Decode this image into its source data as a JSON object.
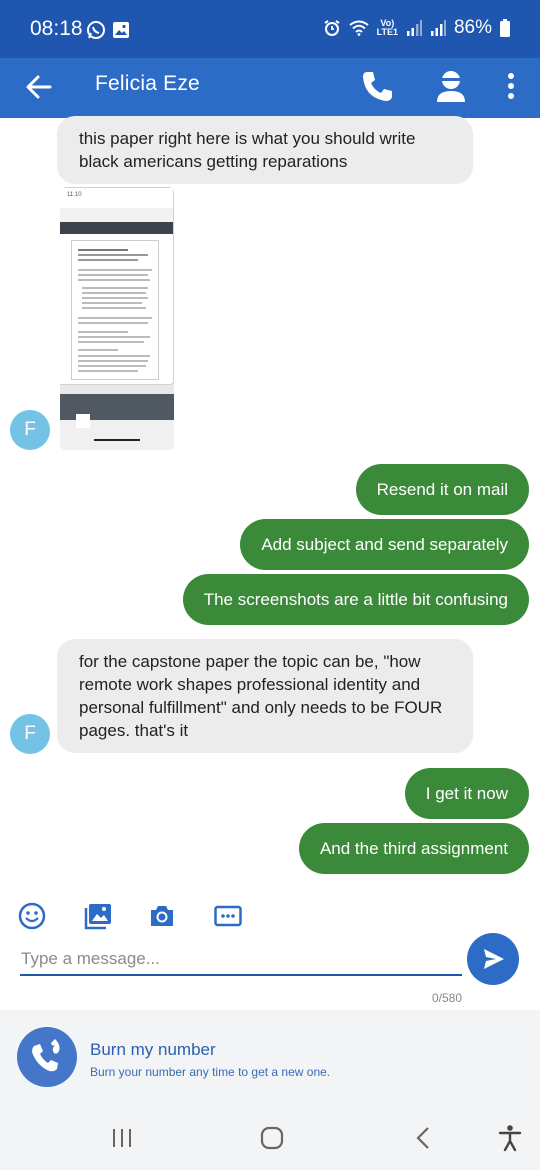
{
  "status_bar": {
    "time": "08:18",
    "network_top": "Vo)",
    "network_bottom": "LTE1",
    "battery": "86%"
  },
  "header": {
    "contact_name": "Felicia Eze"
  },
  "messages": [
    {
      "direction": "in",
      "text": "this paper right here is what you should write black americans getting reparations"
    },
    {
      "direction": "in",
      "type": "image",
      "avatar_initial": "F"
    },
    {
      "direction": "out",
      "text": "Resend it on mail"
    },
    {
      "direction": "out",
      "text": "Add subject and send separately"
    },
    {
      "direction": "out",
      "text": "The screenshots are a little bit confusing"
    },
    {
      "direction": "in",
      "text": "for the capstone paper the topic can be, \"how remote work shapes professional identity and personal fulfillment\" and only needs to be FOUR pages. that's it",
      "avatar_initial": "F"
    },
    {
      "direction": "out",
      "text": "I get it now"
    },
    {
      "direction": "out",
      "text": "And the third assignment"
    }
  ],
  "composer": {
    "placeholder": "Type a message...",
    "char_count": "0/580",
    "icons": [
      "emoji-icon",
      "gallery-icon",
      "camera-icon",
      "more-icon"
    ]
  },
  "burn_banner": {
    "title": "Burn my number",
    "subtitle": "Burn your number any time to get a new one."
  },
  "colors": {
    "header": "#2c6bc6",
    "status_bar": "#1f57b0",
    "outgoing_bubble": "#3b8a39",
    "incoming_bubble": "#ececec",
    "avatar": "#74c3e4"
  }
}
